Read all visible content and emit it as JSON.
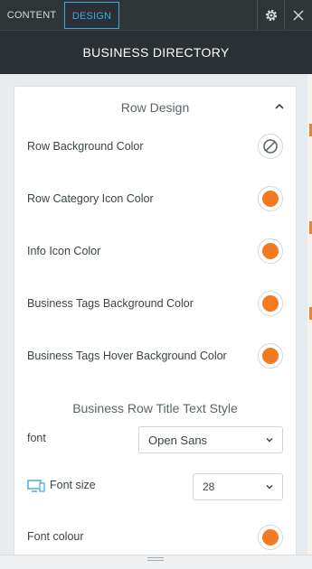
{
  "tabs": [
    {
      "label": "CONTENT",
      "active": false
    },
    {
      "label": "DESIGN",
      "active": true
    }
  ],
  "header": {
    "title": "BUSINESS DIRECTORY",
    "settings_icon": "gear-icon",
    "close_icon": "close-icon"
  },
  "row_design": {
    "section_title": "Row Design",
    "items": [
      {
        "label": "Row Background Color",
        "color": "none"
      },
      {
        "label": "Row Category Icon Color",
        "color": "#f47a20"
      },
      {
        "label": "Info Icon Color",
        "color": "#f47a20"
      },
      {
        "label": "Business Tags Background Color",
        "color": "#f47a20"
      },
      {
        "label": "Business Tags Hover Background Color",
        "color": "#f47a20"
      }
    ]
  },
  "title_text_style": {
    "section_title": "Business Row Title Text Style",
    "font_label": "font",
    "font_value": "Open Sans",
    "font_size_label": "Font size",
    "font_size_value": "28",
    "font_colour_label": "Font colour",
    "font_colour": "#f47a20"
  },
  "colors": {
    "accent": "#3ea8e0",
    "swatch_orange": "#f47a20",
    "header_bg": "#2a3033"
  }
}
